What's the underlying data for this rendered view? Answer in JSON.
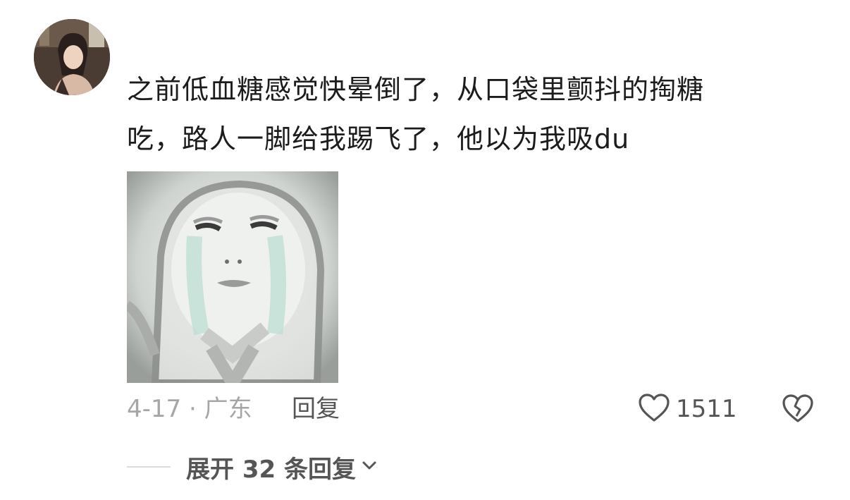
{
  "comment": {
    "text_line1": "之前低血糖感觉快晕倒了，从口袋里颤抖的掏糖",
    "text_line2": "吃，路人一脚给我踢飞了，他以为我吸du",
    "date_location": "4-17 · 广东",
    "reply_label": "回复",
    "like_count": "1511"
  },
  "expand_replies": {
    "label": "展开 32 条回复"
  },
  "icons": {
    "avatar": "user-avatar",
    "sticker": "crying-meme-sticker",
    "like": "heart-outline-icon",
    "dislike": "broken-heart-icon",
    "expand": "chevron-down-icon"
  }
}
